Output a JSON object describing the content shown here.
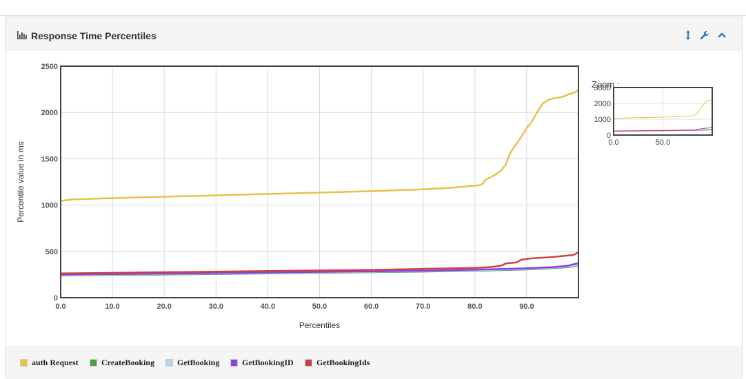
{
  "panel": {
    "title": "Response Time Percentiles",
    "icons": [
      "bar-chart-icon",
      "resize-vertical-icon",
      "wrench-icon",
      "chevron-up-icon"
    ]
  },
  "zoom": {
    "label": "Zoom :",
    "y_ticks": [
      "3000",
      "2000",
      "1000",
      "0"
    ],
    "x_ticks": [
      "0.0",
      "50.0"
    ],
    "ylim": [
      0,
      3000
    ]
  },
  "chart_data": {
    "type": "line",
    "xlabel": "Percentiles",
    "ylabel": "Percentile value in ms",
    "xlim": [
      0,
      100
    ],
    "ylim": [
      0,
      2500
    ],
    "x_ticks": [
      "0.0",
      "10.0",
      "20.0",
      "30.0",
      "40.0",
      "50.0",
      "60.0",
      "70.0",
      "80.0",
      "90.0"
    ],
    "y_ticks": [
      "0",
      "500",
      "1000",
      "1500",
      "2000",
      "2500"
    ],
    "grid": true,
    "legend_position": "bottom",
    "series": [
      {
        "name": "auth Request",
        "color": "#e8c04a",
        "points": [
          [
            0,
            1045
          ],
          [
            2,
            1060
          ],
          [
            10,
            1075
          ],
          [
            20,
            1090
          ],
          [
            30,
            1105
          ],
          [
            40,
            1120
          ],
          [
            50,
            1135
          ],
          [
            60,
            1150
          ],
          [
            70,
            1170
          ],
          [
            75,
            1185
          ],
          [
            78,
            1200
          ],
          [
            81,
            1215
          ],
          [
            81.5,
            1230
          ],
          [
            82,
            1270
          ],
          [
            83,
            1300
          ],
          [
            84,
            1330
          ],
          [
            85,
            1370
          ],
          [
            86,
            1440
          ],
          [
            86.5,
            1520
          ],
          [
            87,
            1580
          ],
          [
            88,
            1660
          ],
          [
            89,
            1740
          ],
          [
            90,
            1830
          ],
          [
            91,
            1900
          ],
          [
            92,
            2000
          ],
          [
            93,
            2090
          ],
          [
            94,
            2130
          ],
          [
            95,
            2150
          ],
          [
            96,
            2160
          ],
          [
            97,
            2170
          ],
          [
            98,
            2195
          ],
          [
            99,
            2210
          ],
          [
            100,
            2240
          ]
        ]
      },
      {
        "name": "CreateBooking",
        "color": "#4aa04a",
        "points": [
          [
            0,
            240
          ],
          [
            20,
            250
          ],
          [
            40,
            262
          ],
          [
            60,
            275
          ],
          [
            70,
            282
          ],
          [
            80,
            290
          ],
          [
            90,
            305
          ],
          [
            95,
            318
          ],
          [
            98,
            330
          ],
          [
            100,
            345
          ]
        ]
      },
      {
        "name": "GetBooking",
        "color": "#b9d3ee",
        "points": [
          [
            0,
            245
          ],
          [
            20,
            256
          ],
          [
            40,
            268
          ],
          [
            60,
            280
          ],
          [
            70,
            288
          ],
          [
            80,
            296
          ],
          [
            90,
            312
          ],
          [
            95,
            325
          ],
          [
            98,
            338
          ],
          [
            100,
            352
          ]
        ]
      },
      {
        "name": "GetBookingID",
        "color": "#8c3ee8",
        "points": [
          [
            0,
            250
          ],
          [
            20,
            260
          ],
          [
            40,
            272
          ],
          [
            60,
            284
          ],
          [
            70,
            292
          ],
          [
            80,
            302
          ],
          [
            90,
            318
          ],
          [
            95,
            330
          ],
          [
            98,
            345
          ],
          [
            99,
            360
          ],
          [
            100,
            372
          ]
        ]
      },
      {
        "name": "GetBookingIds",
        "color": "#d04040",
        "points": [
          [
            0,
            262
          ],
          [
            20,
            275
          ],
          [
            40,
            288
          ],
          [
            60,
            300
          ],
          [
            70,
            312
          ],
          [
            80,
            322
          ],
          [
            83,
            330
          ],
          [
            85,
            345
          ],
          [
            86,
            370
          ],
          [
            88,
            380
          ],
          [
            89,
            410
          ],
          [
            91,
            425
          ],
          [
            94,
            435
          ],
          [
            96,
            445
          ],
          [
            98,
            455
          ],
          [
            99,
            460
          ],
          [
            100,
            490
          ]
        ]
      }
    ]
  }
}
